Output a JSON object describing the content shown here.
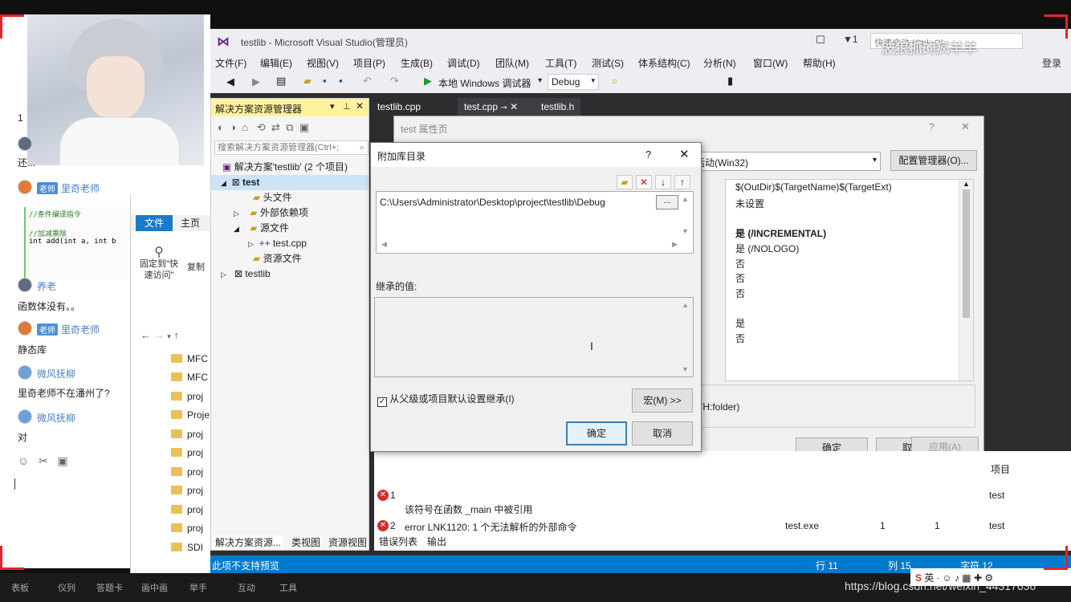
{
  "chat": {
    "top_num": "1",
    "messages": [
      {
        "text": "还..."
      },
      {
        "user": "里奇老师",
        "badge": "老师"
      },
      {
        "user": "养老",
        "text": "函数体没有。。"
      },
      {
        "user": "里奇老师",
        "badge": "老师",
        "text": "静态库"
      },
      {
        "user": "微风抚柳",
        "text": "里奇老师不在潘州了?"
      },
      {
        "user": "微风抚柳",
        "text": "对"
      }
    ],
    "code": [
      "//条件编译指令",
      "",
      "//加减乘除",
      "int add(int a, int b"
    ]
  },
  "explorer": {
    "tab_file": "文件",
    "tab_home": "主页",
    "pin_label": "固定到\"快速访问\"",
    "copy_label": "复制",
    "items": [
      "MFC",
      "MFC",
      "proj",
      "Proje",
      "proj",
      "proj",
      "proj",
      "proj",
      "proj",
      "proj",
      "SDI"
    ]
  },
  "vs": {
    "title": "testlib - Microsoft Visual Studio(管理员)",
    "quick_launch": "快速启动 (Ctrl+Q)",
    "login": "登录",
    "flag_count": "1",
    "menu": [
      "文件(F)",
      "编辑(E)",
      "视图(V)",
      "项目(P)",
      "生成(B)",
      "调试(D)",
      "团队(M)",
      "工具(T)",
      "测试(S)",
      "体系结构(C)",
      "分析(N)",
      "窗口(W)",
      "帮助(H)"
    ],
    "run_target": "本地 Windows 调试器",
    "config": "Debug",
    "solution_explorer": {
      "title": "解决方案资源管理器",
      "search_placeholder": "搜索解决方案资源管理器(Ctrl+;",
      "tree": {
        "solution": "解决方案'testlib' (2 个项目)",
        "project": "test",
        "headers": "头文件",
        "external": "外部依赖项",
        "sources": "源文件",
        "file": "test.cpp",
        "resources": "资源文件",
        "project2": "testlib"
      },
      "bottom_tabs": [
        "解决方案资源...",
        "类视图",
        "资源视图"
      ]
    },
    "doc_tabs": [
      "testlib.cpp",
      "test.cpp",
      "testlib.h"
    ],
    "property_page": {
      "title": "test 属性页",
      "help": "?",
      "platform": "活动(Win32)",
      "config_manager": "配置管理器(O)...",
      "values": [
        "$(OutDir)$(TargetName)$(TargetExt)",
        "未设置",
        "",
        "是 (/INCREMENTAL)",
        "是 (/NOLOGO)",
        "否",
        "否",
        "否",
        "",
        "是",
        "否"
      ],
      "path_hint": "TH:folder)",
      "ok": "确定",
      "cancel": "取消",
      "apply": "应用(A)"
    },
    "error_list": {
      "col_project": "项目",
      "rows": [
        {
          "num": "1",
          "desc": "该符号在函数 _main 中被引用",
          "file": "",
          "line": "",
          "col": "",
          "project": "test"
        },
        {
          "num": "2",
          "desc": "error LNK1120: 1 个无法解析的外部命令",
          "file": "test.exe",
          "line": "1",
          "col": "1",
          "project": "test"
        }
      ],
      "tabs": [
        "错误列表",
        "输出"
      ]
    },
    "status": {
      "left": "此项不支持预览",
      "row": "行 11",
      "col": "列 15",
      "char": "字符 12"
    }
  },
  "dialog": {
    "title": "附加库目录",
    "help": "?",
    "path": "C:\\Users\\Administrator\\Desktop\\project\\testlib\\Debug",
    "browse": "...",
    "inherited_label": "继承的值:",
    "inherit_checkbox": "从父级或项目默认设置继承(I)",
    "inherit_checked": true,
    "macros": "宏(M) >>",
    "ok": "确定",
    "cancel": "取消"
  },
  "watermark": "https://blog.csdn.net/weixin_44317636",
  "overlay_brand": "波狼抓的疯羊羊",
  "taskbar": {
    "items": [
      "表板",
      "仪列",
      "答题卡",
      "画中画",
      "举手",
      "互动",
      "工具"
    ],
    "ime": "英"
  },
  "colors": {
    "accent": "#007acc",
    "highlight": "#fff29d",
    "error": "#d62b2b",
    "recording": "#e0262a"
  }
}
